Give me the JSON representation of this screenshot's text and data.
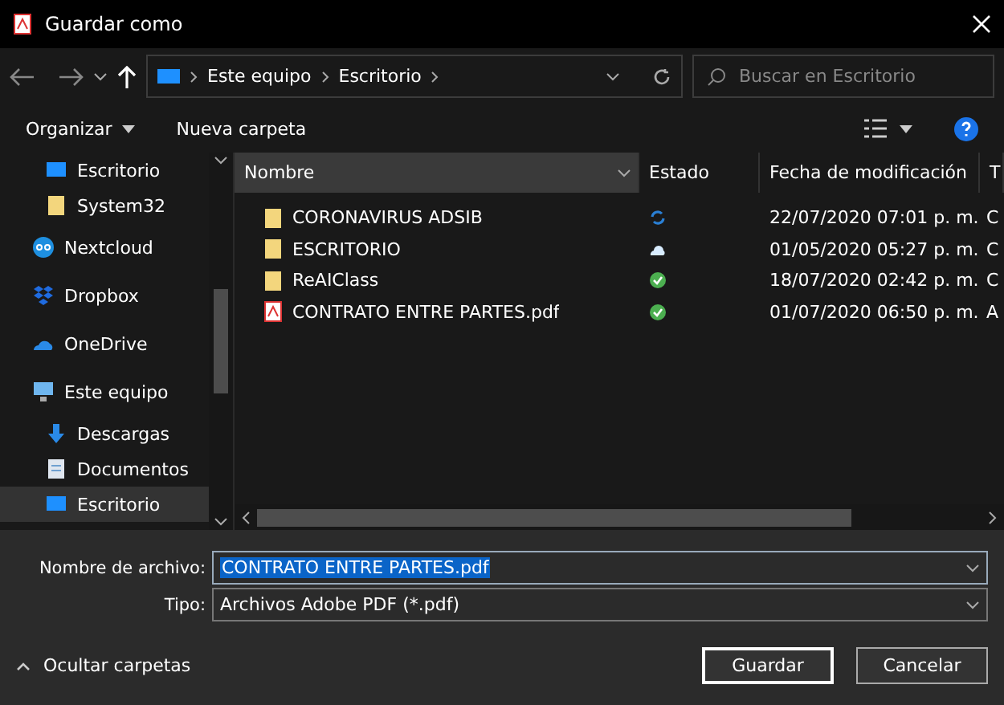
{
  "window": {
    "title": "Guardar como"
  },
  "nav": {
    "path": [
      "Este equipo",
      "Escritorio"
    ],
    "search": {
      "placeholder": "Buscar en Escritorio"
    }
  },
  "toolbar": {
    "organize": "Organizar",
    "new_folder": "Nueva carpeta"
  },
  "sidebar": {
    "items": [
      {
        "label": "Escritorio",
        "kind": "monitor",
        "pinned": true,
        "selected": false
      },
      {
        "label": "System32",
        "kind": "folder",
        "pinned": true,
        "selected": false
      },
      {
        "label": "Nextcloud",
        "kind": "nextcloud",
        "pinned": false,
        "selected": false
      },
      {
        "label": "Dropbox",
        "kind": "dropbox",
        "pinned": false,
        "selected": false
      },
      {
        "label": "OneDrive",
        "kind": "onedrive",
        "pinned": false,
        "selected": false
      },
      {
        "label": "Este equipo",
        "kind": "pc",
        "pinned": false,
        "selected": false,
        "children": [
          {
            "label": "Descargas",
            "kind": "download",
            "selected": false
          },
          {
            "label": "Documentos",
            "kind": "document",
            "selected": false
          },
          {
            "label": "Escritorio",
            "kind": "monitor",
            "selected": true
          }
        ]
      }
    ]
  },
  "table": {
    "columns": [
      "Nombre",
      "Estado",
      "Fecha de modificación",
      "T"
    ],
    "rows": [
      {
        "name": "CORONAVIRUS ADSIB",
        "kind": "folder",
        "status": {
          "kind": "sync"
        },
        "date": "22/07/2020 07:01 p. m.",
        "column_4": "C"
      },
      {
        "name": "ESCRITORIO",
        "kind": "folder",
        "status": {
          "kind": "cloud"
        },
        "date": "01/05/2020 05:27 p. m.",
        "column_4": "C"
      },
      {
        "name": "ReAIClass",
        "kind": "folder",
        "status": {
          "kind": "ok"
        },
        "date": "18/07/2020 02:42 p. m.",
        "column_4": "C"
      },
      {
        "name": "CONTRATO ENTRE PARTES.pdf",
        "kind": "pdf",
        "status": {
          "kind": "ok"
        },
        "date": "01/07/2020 06:50 p. m.",
        "column_4": "A"
      }
    ]
  },
  "form": {
    "filename_label": "Nombre de archivo:",
    "filename": "CONTRATO ENTRE PARTES.pdf",
    "type_label": "Tipo:",
    "type": "Archivos Adobe PDF (*.pdf)"
  },
  "footer": {
    "toggle": "Ocultar carpetas",
    "buttons": [
      "Guardar",
      "Cancelar"
    ]
  }
}
